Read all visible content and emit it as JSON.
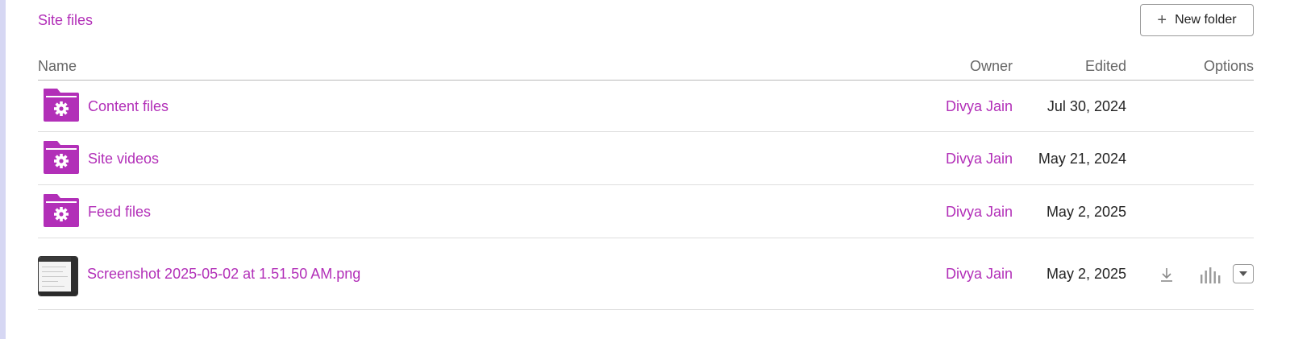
{
  "breadcrumb": {
    "label": "Site files"
  },
  "toolbar": {
    "new_folder_label": "New folder",
    "new_folder_icon": "plus-icon"
  },
  "table": {
    "columns": {
      "name": "Name",
      "owner": "Owner",
      "edited": "Edited",
      "options": "Options"
    },
    "rows": [
      {
        "type": "folder",
        "icon": "folder-gear-icon",
        "name": "Content files",
        "owner": "Divya Jain",
        "edited": "Jul 30, 2024"
      },
      {
        "type": "folder",
        "icon": "folder-gear-icon",
        "name": "Site videos",
        "owner": "Divya Jain",
        "edited": "May 21, 2024"
      },
      {
        "type": "folder",
        "icon": "folder-gear-icon",
        "name": "Feed files",
        "owner": "Divya Jain",
        "edited": "May 2, 2025"
      },
      {
        "type": "file",
        "icon": "image-thumbnail",
        "name": "Screenshot 2025-05-02 at 1.51.50 AM.png",
        "owner": "Divya Jain",
        "edited": "May 2, 2025",
        "options": [
          "download-icon",
          "stats-icon",
          "chevron-down-icon"
        ]
      }
    ]
  },
  "colors": {
    "accent": "#b22fb8",
    "text": "#222222",
    "muted": "#666666",
    "divider": "#dedede"
  }
}
